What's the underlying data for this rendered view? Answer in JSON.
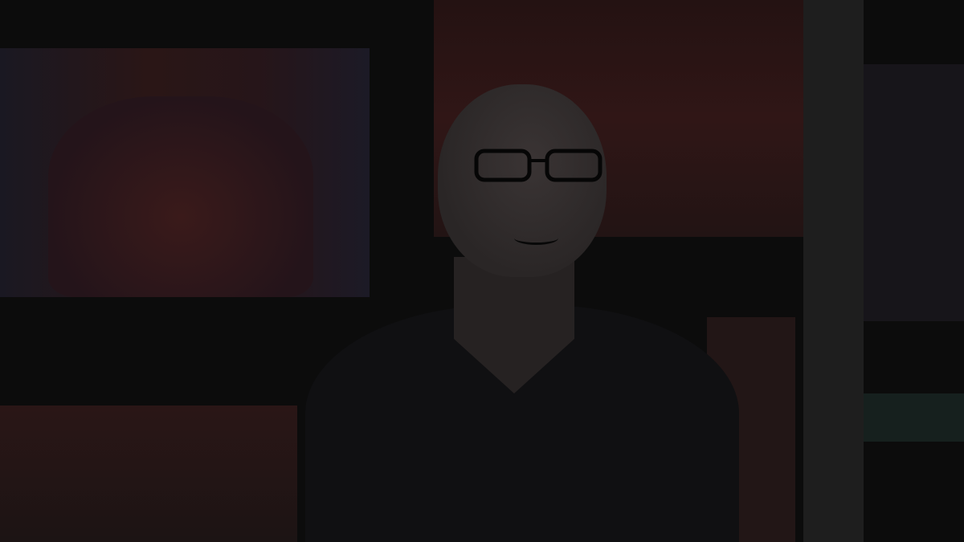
{
  "scene": {
    "subject": "person-with-glasses",
    "background_color": "#0c0c0c",
    "accent_colors": [
      "#140d0d",
      "#0f0e13",
      "#0c100f"
    ]
  }
}
